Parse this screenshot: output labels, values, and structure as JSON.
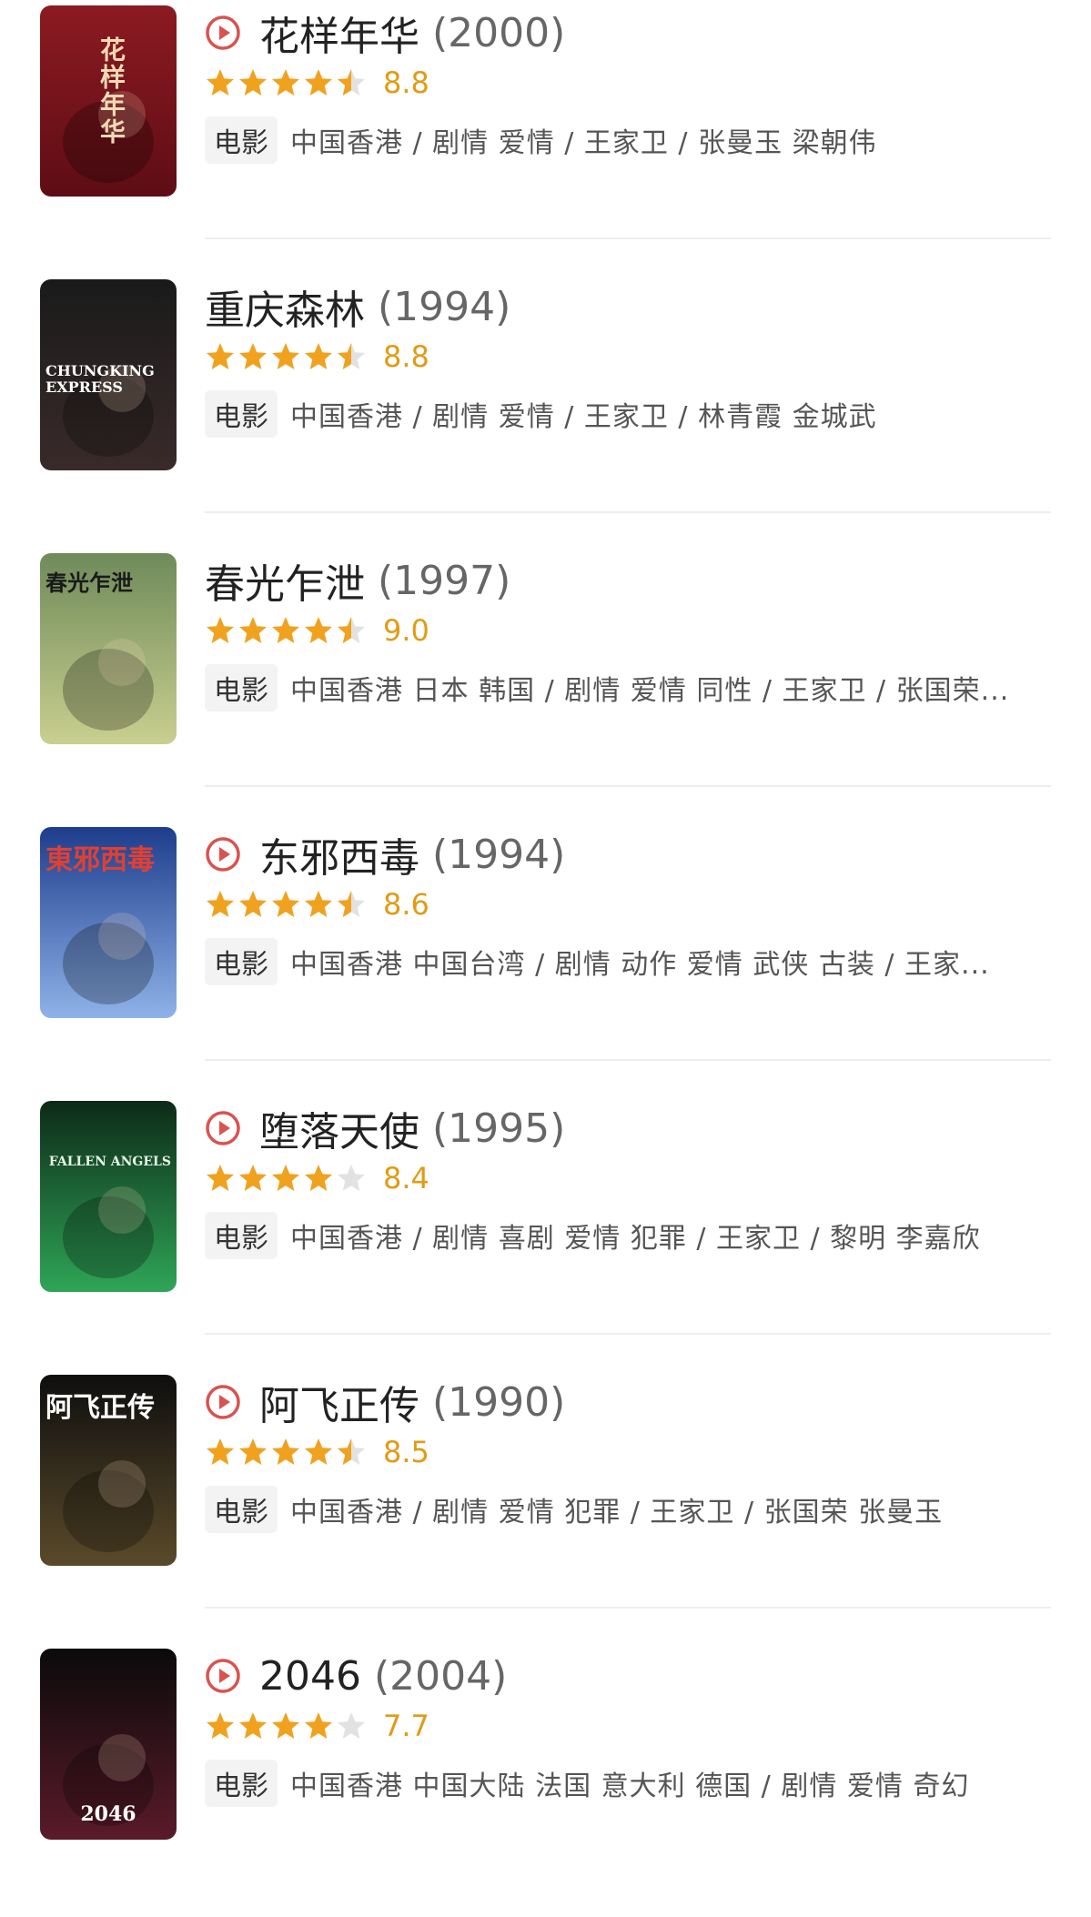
{
  "category_label": "电影",
  "accent_color": "#d9534f",
  "star_color": "#f0a21f",
  "star_empty_color": "#e2e2e2",
  "movies": [
    {
      "title": "花样年华",
      "year": "(2000)",
      "has_play": true,
      "stars": 4.5,
      "score": "8.8",
      "meta": "中国香港 / 剧情 爱情 / 王家卫 / 张曼玉 梁朝伟",
      "poster_text": "花样年华"
    },
    {
      "title": "重庆森林",
      "year": "(1994)",
      "has_play": false,
      "stars": 4.5,
      "score": "8.8",
      "meta": "中国香港 / 剧情 爱情 / 王家卫 / 林青霞 金城武",
      "poster_text": "CHUNGKING EXPRESS"
    },
    {
      "title": "春光乍泄",
      "year": "(1997)",
      "has_play": false,
      "stars": 4.5,
      "score": "9.0",
      "meta": "中国香港 日本 韩国 / 剧情 爱情 同性 / 王家卫 / 张国荣...",
      "poster_text": "春光乍泄"
    },
    {
      "title": "东邪西毒",
      "year": "(1994)",
      "has_play": true,
      "stars": 4.5,
      "score": "8.6",
      "meta": "中国香港 中国台湾 / 剧情 动作 爱情 武侠 古装 / 王家...",
      "poster_text": "東邪西毒"
    },
    {
      "title": "堕落天使",
      "year": "(1995)",
      "has_play": true,
      "stars": 4,
      "score": "8.4",
      "meta": "中国香港 / 剧情 喜剧 爱情 犯罪 / 王家卫 / 黎明 李嘉欣",
      "poster_text": "FALLEN ANGELS"
    },
    {
      "title": "阿飞正传",
      "year": "(1990)",
      "has_play": true,
      "stars": 4.5,
      "score": "8.5",
      "meta": "中国香港 / 剧情 爱情 犯罪 / 王家卫 / 张国荣 张曼玉",
      "poster_text": "阿飞正传"
    },
    {
      "title": "2046",
      "year": "(2004)",
      "has_play": true,
      "stars": 4,
      "score": "7.7",
      "meta": "中国香港 中国大陆 法国 意大利 德国 / 剧情 爱情 奇幻",
      "poster_text": "2046"
    }
  ]
}
